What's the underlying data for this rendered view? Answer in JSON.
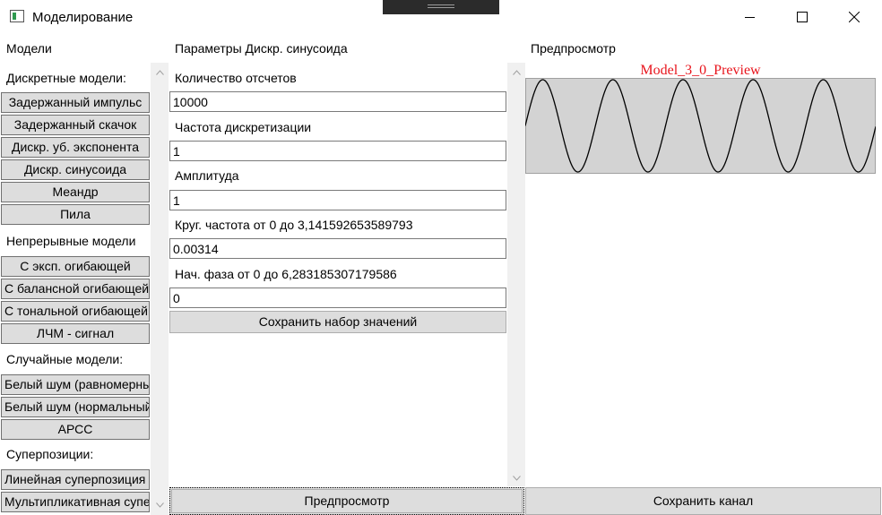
{
  "window": {
    "title": "Моделирование",
    "controls": {
      "minimize": "minimize-icon",
      "maximize": "maximize-icon",
      "close": "close-icon"
    }
  },
  "models_panel": {
    "header": "Модели",
    "sections": {
      "discrete": "Дискретные модели:",
      "continuous": "Непрерывные модели",
      "random": "Случайные модели:",
      "superpositions": "Суперпозиции:"
    },
    "buttons": {
      "delayed_impulse": "Задержанный импульс",
      "delayed_step": "Задержанный скачок",
      "discr_exp": "Дискр. уб. экспонента",
      "discr_sin": "Дискр. синусоида",
      "meander": "Меандр",
      "saw": "Пила",
      "exp_envelope": "С эксп. огибающей",
      "balance_envelope": "С балансной огибающей",
      "tonal_envelope": "С тональной огибающей",
      "lfm": "ЛЧМ - сигнал",
      "white_uniform": "Белый шум (равномерный)",
      "white_normal": "Белый шум (нормальный)",
      "arss": "АРСС",
      "linear_sup": "Линейная суперпозиция",
      "mult_sup": "Мультипликативная суперпозиция"
    }
  },
  "params_panel": {
    "header": "Параметры Дискр. синусоида",
    "fields": {
      "count": {
        "label": "Количество отсчетов",
        "value": "10000"
      },
      "rate": {
        "label": "Частота дискретизации",
        "value": "1"
      },
      "amplitude": {
        "label": "Амплитуда",
        "value": "1"
      },
      "freq": {
        "label": "Круг. частота от 0 до 3,141592653589793",
        "value": "0.00314"
      },
      "phase": {
        "label": "Нач. фаза от 0 до 6,283185307179586",
        "value": "0"
      }
    },
    "save_values_label": "Сохранить набор значений"
  },
  "preview_panel": {
    "header": "Предпросмотр"
  },
  "footer": {
    "preview_label": "Предпросмотр",
    "save_channel_label": "Сохранить канал"
  },
  "chart_data": {
    "type": "line",
    "title": "Model_3_0_Preview",
    "series": [
      {
        "amplitude": 1,
        "frequency": 0.00314,
        "phase": 0,
        "samples": 10000
      }
    ],
    "ylim": [
      -1,
      1
    ],
    "colors": {
      "line": "#000000",
      "background": "#d3d3d3",
      "title": "#e8141c"
    }
  }
}
